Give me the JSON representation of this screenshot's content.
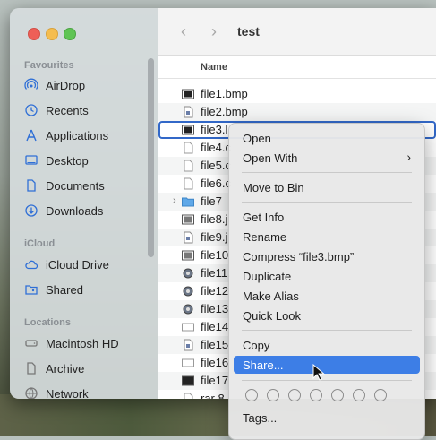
{
  "window": {
    "title": "test",
    "nav_back": "‹",
    "nav_forward": "›"
  },
  "sidebar": {
    "favourites_label": "Favourites",
    "favourites": [
      {
        "label": "AirDrop",
        "icon": "airdrop-icon"
      },
      {
        "label": "Recents",
        "icon": "clock-icon"
      },
      {
        "label": "Applications",
        "icon": "applications-icon"
      },
      {
        "label": "Desktop",
        "icon": "desktop-icon"
      },
      {
        "label": "Documents",
        "icon": "document-icon"
      },
      {
        "label": "Downloads",
        "icon": "download-icon"
      }
    ],
    "icloud_label": "iCloud",
    "icloud": [
      {
        "label": "iCloud Drive",
        "icon": "cloud-icon"
      },
      {
        "label": "Shared",
        "icon": "shared-folder-icon"
      }
    ],
    "locations_label": "Locations",
    "locations": [
      {
        "label": "Macintosh HD",
        "icon": "drive-icon"
      },
      {
        "label": "Archive",
        "icon": "document-icon"
      },
      {
        "label": "Network",
        "icon": "network-icon"
      }
    ]
  },
  "file_list": {
    "column_name": "Name",
    "files": [
      {
        "name": "file1.bmp"
      },
      {
        "name": "file2.bmp"
      },
      {
        "name": "file3.l"
      },
      {
        "name": "file4.c"
      },
      {
        "name": "file5.c"
      },
      {
        "name": "file6.c"
      },
      {
        "name": "file7"
      },
      {
        "name": "file8.j"
      },
      {
        "name": "file9.j"
      },
      {
        "name": "file10"
      },
      {
        "name": "file11."
      },
      {
        "name": "file12"
      },
      {
        "name": "file13"
      },
      {
        "name": "file14"
      },
      {
        "name": "file15"
      },
      {
        "name": "file16"
      },
      {
        "name": "file17"
      },
      {
        "name": "rar 8"
      }
    ]
  },
  "context_menu": {
    "open": "Open",
    "open_with": "Open With",
    "move_to_bin": "Move to Bin",
    "get_info": "Get Info",
    "rename": "Rename",
    "compress": "Compress “file3.bmp”",
    "duplicate": "Duplicate",
    "make_alias": "Make Alias",
    "quick_look": "Quick Look",
    "copy": "Copy",
    "share": "Share...",
    "tags": "Tags...",
    "submenu_arrow": "›"
  }
}
